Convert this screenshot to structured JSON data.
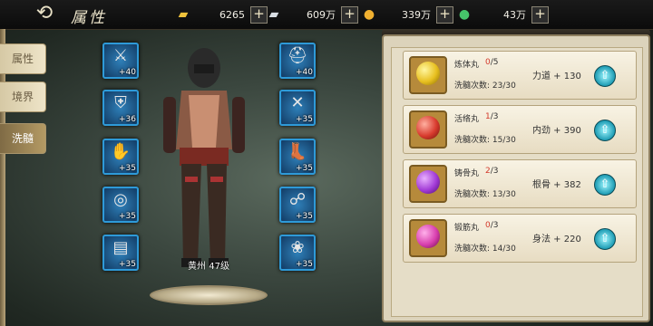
{
  "header": {
    "title": "属性",
    "resources": [
      {
        "name": "gold-ingot",
        "icon": "gold-ingot-icon",
        "value": "6265",
        "color": "#f0c33c"
      },
      {
        "name": "silver-ingot",
        "icon": "silver-ingot-icon",
        "value": "609万",
        "color": "#d8dde3"
      },
      {
        "name": "copper-coin",
        "icon": "coin-icon",
        "value": "339万",
        "color": "#f0b030"
      },
      {
        "name": "jade",
        "icon": "jade-icon",
        "value": "43万",
        "color": "#46c46a"
      }
    ],
    "plus_label": "+"
  },
  "tabs": [
    {
      "label": "属性",
      "active": false
    },
    {
      "label": "境界",
      "active": false
    },
    {
      "label": "洗髓",
      "active": true
    }
  ],
  "equipment_left": [
    {
      "icon": "sword-icon",
      "glyph": "⚔",
      "level": "+40"
    },
    {
      "icon": "armor-icon",
      "glyph": "⛨",
      "level": "+36"
    },
    {
      "icon": "gauntlet-icon",
      "glyph": "✋",
      "level": "+35"
    },
    {
      "icon": "ring-icon",
      "glyph": "◎",
      "level": "+35"
    },
    {
      "icon": "scroll-icon",
      "glyph": "▤",
      "level": "+35"
    }
  ],
  "equipment_right": [
    {
      "icon": "helmet-icon",
      "glyph": "⛑",
      "level": "+40"
    },
    {
      "icon": "belt-icon",
      "glyph": "✕",
      "level": "+35"
    },
    {
      "icon": "boots-icon",
      "glyph": "👢",
      "level": "+35"
    },
    {
      "icon": "pendant-icon",
      "glyph": "☍",
      "level": "+35"
    },
    {
      "icon": "token-icon",
      "glyph": "❀",
      "level": "+35"
    }
  ],
  "character": {
    "name": "黄州 47级"
  },
  "pills": [
    {
      "name": "炼体丸",
      "current": "0",
      "max": "/5",
      "wash_label": "洗髓次数:",
      "wash_value": "23/30",
      "bonus": "力道 + 130",
      "color": "#e8c020"
    },
    {
      "name": "活络丸",
      "current": "1",
      "max": "/3",
      "wash_label": "洗髓次数:",
      "wash_value": "15/30",
      "bonus": "内劲 + 390",
      "color": "#d83b2e"
    },
    {
      "name": "铸骨丸",
      "current": "2",
      "max": "/3",
      "wash_label": "洗髓次数:",
      "wash_value": "13/30",
      "bonus": "根骨 + 382",
      "color": "#a23bd6"
    },
    {
      "name": "锻筋丸",
      "current": "0",
      "max": "/3",
      "wash_label": "洗髓次数:",
      "wash_value": "14/30",
      "bonus": "身法 + 220",
      "color": "#d83fae"
    }
  ],
  "upgrade_glyph": "⇧"
}
